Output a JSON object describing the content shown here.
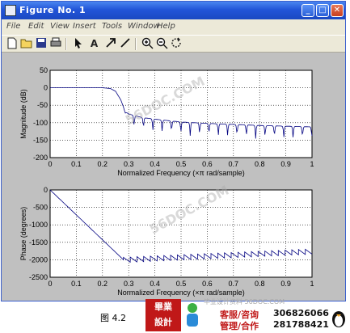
{
  "window": {
    "title": "Figure No. 1",
    "menus": [
      "File",
      "Edit",
      "View",
      "Insert",
      "Tools",
      "Window",
      "Help"
    ],
    "controls": {
      "minimize": "_",
      "maximize": "□",
      "close": "✕"
    }
  },
  "toolbar": {
    "icons": [
      "new-file-icon",
      "open-folder-icon",
      "save-icon",
      "print-icon",
      "pointer-arrow-icon",
      "text-A-icon",
      "arrow-tool-icon",
      "line-tool-icon",
      "zoom-in-icon",
      "zoom-out-icon",
      "rotate-icon"
    ],
    "text_tool": "A"
  },
  "chart_data": [
    {
      "type": "line",
      "xlabel": "Normalized Frequency  (×π rad/sample)",
      "ylabel": "Magnitude (dB)",
      "xlim": [
        0,
        1
      ],
      "ylim": [
        -200,
        50
      ],
      "xticks": [
        "0",
        "0.1",
        "0.2",
        "0.3",
        "0.4",
        "0.5",
        "0.6",
        "0.7",
        "0.8",
        "0.9",
        "1"
      ],
      "yticks": [
        "50",
        "0",
        "-50",
        "-100",
        "-150",
        "-200"
      ],
      "grid": true,
      "color": "#000080",
      "x": [
        0,
        0.1,
        0.2,
        0.23,
        0.25,
        0.27,
        0.28,
        0.29,
        0.3,
        0.35,
        0.4,
        0.5,
        0.6,
        0.7,
        0.8,
        0.9,
        1.0
      ],
      "y": [
        0,
        0,
        0,
        -2,
        -10,
        -35,
        -55,
        -80,
        -85,
        -95,
        -100,
        -108,
        -112,
        -115,
        -118,
        -120,
        -122
      ]
    },
    {
      "type": "line",
      "xlabel": "Normalized Frequency  (×π rad/sample)",
      "ylabel": "Phase (degrees)",
      "xlim": [
        0,
        1
      ],
      "ylim": [
        -2500,
        0
      ],
      "xticks": [
        "0",
        "0.1",
        "0.2",
        "0.3",
        "0.4",
        "0.5",
        "0.6",
        "0.7",
        "0.8",
        "0.9",
        "1"
      ],
      "yticks": [
        "0",
        "-500",
        "-1000",
        "-1500",
        "-2000",
        "-2500"
      ],
      "grid": true,
      "color": "#000080",
      "x": [
        0,
        0.28,
        0.3,
        1.0
      ],
      "y": [
        0,
        -2000,
        -1960,
        -1760
      ]
    }
  ],
  "caption": "图 4.2",
  "ad": {
    "logo_text_top": "畢業",
    "logo_text_bottom": "設計",
    "line1_label": "客服/咨询",
    "line1_number": "306826066",
    "line2_label": "管理/合作",
    "line2_number": "281788421",
    "site": "毕业设计资料 56DOC.COM"
  },
  "watermarks": [
    "56DOC.COM",
    "56DOC.COM"
  ]
}
